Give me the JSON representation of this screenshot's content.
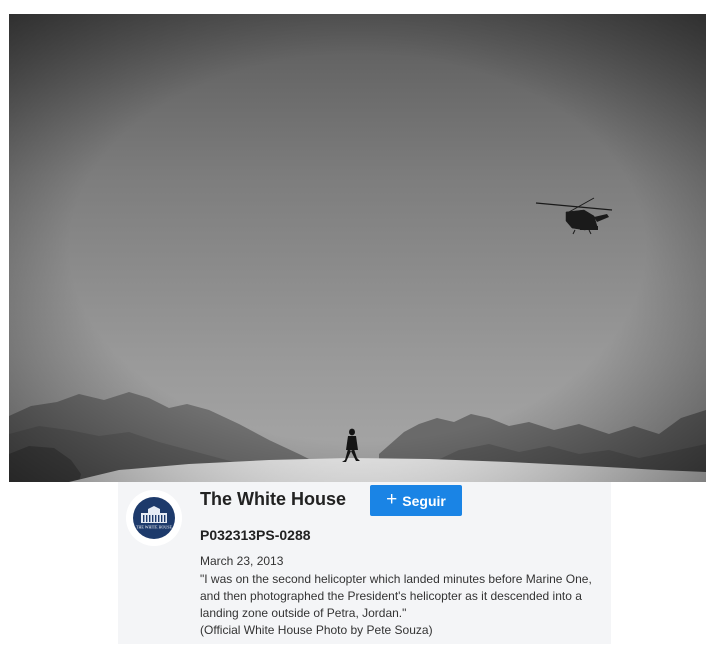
{
  "photo": {
    "subject": "helicopter over desert landing zone with walking figure"
  },
  "account": {
    "name": "The White House",
    "avatar_icon": "white-house-seal-icon",
    "avatar_seal_text": "THE WHITE HOUSE"
  },
  "follow_button": {
    "icon": "plus-icon",
    "icon_glyph": "+",
    "label": "Seguir",
    "color": "#1a84e5"
  },
  "caption": {
    "photo_id": "P032313PS-0288",
    "date": "March 23, 2013",
    "description": "\"I was on the second helicopter which landed minutes before Marine One, and then photographed the President's helicopter as it descended into a landing zone outside of Petra, Jordan.\"",
    "credit": "(Official White House Photo by Pete Souza)"
  }
}
